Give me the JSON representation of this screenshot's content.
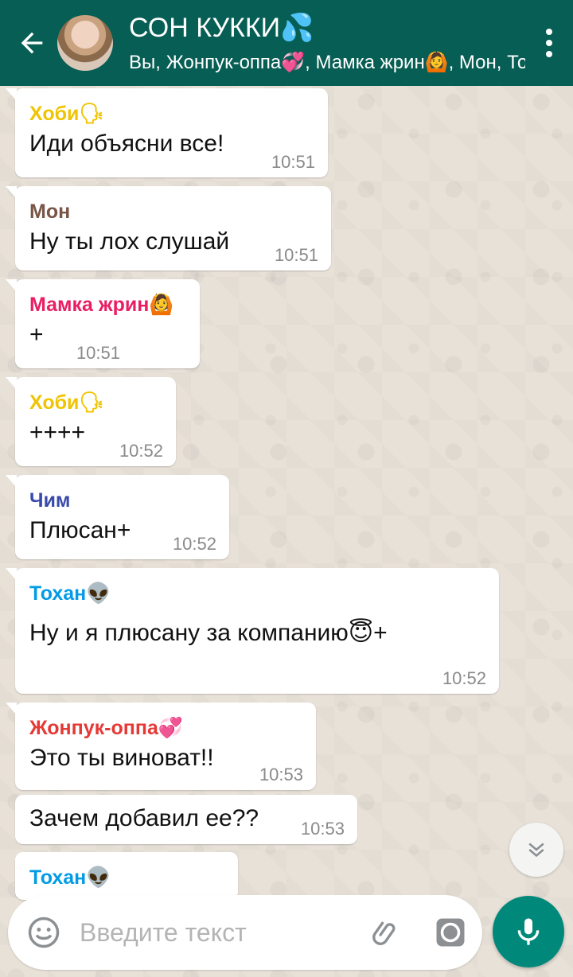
{
  "header": {
    "title": "СОН КУККИ💦",
    "members": "Вы, Жонпук-оппа💞, Мамка жрин🙆, Мон, Тохан👽, Хоби🗣, Чим",
    "back_icon": "arrow-left-icon",
    "menu_icon": "more-vertical-icon"
  },
  "messages": [
    {
      "sender": "Хоби🗣",
      "sender_color": "#f0c400",
      "text": "Иди объясни все!",
      "time": "10:51"
    },
    {
      "sender": "Мон",
      "sender_color": "#795548",
      "text": "Ну ты лох слушай",
      "time": "10:51"
    },
    {
      "sender": "Мамка жрин🙆",
      "sender_color": "#e91e63",
      "text": "+",
      "time": "10:51"
    },
    {
      "sender": "Хоби🗣",
      "sender_color": "#f0c400",
      "text": "++++",
      "time": "10:52"
    },
    {
      "sender": "Чим",
      "sender_color": "#3949ab",
      "text": "Плюсан+",
      "time": "10:52"
    },
    {
      "sender": "Тохан👽",
      "sender_color": "#039be5",
      "text": "Ну и я плюсану за компанию😇+",
      "time": "10:52"
    },
    {
      "sender": "Жонпук-оппа💞",
      "sender_color": "#e53935",
      "text": "Это ты виноват!!",
      "time": "10:53"
    },
    {
      "sender": "",
      "sender_color": "",
      "text": "Зачем добавил ее??",
      "time": "10:53"
    },
    {
      "sender": "Тохан👽",
      "sender_color": "#039be5",
      "text": "",
      "time": ""
    }
  ],
  "input": {
    "placeholder": "Введите текст",
    "emoji_icon": "emoji-icon",
    "attach_icon": "paperclip-icon",
    "camera_icon": "camera-icon",
    "mic_icon": "microphone-icon",
    "scroll_icon": "chevron-double-down-icon"
  },
  "colors": {
    "header": "#075e54",
    "mic": "#00897b",
    "wallpaper": "#e5ddd4"
  }
}
